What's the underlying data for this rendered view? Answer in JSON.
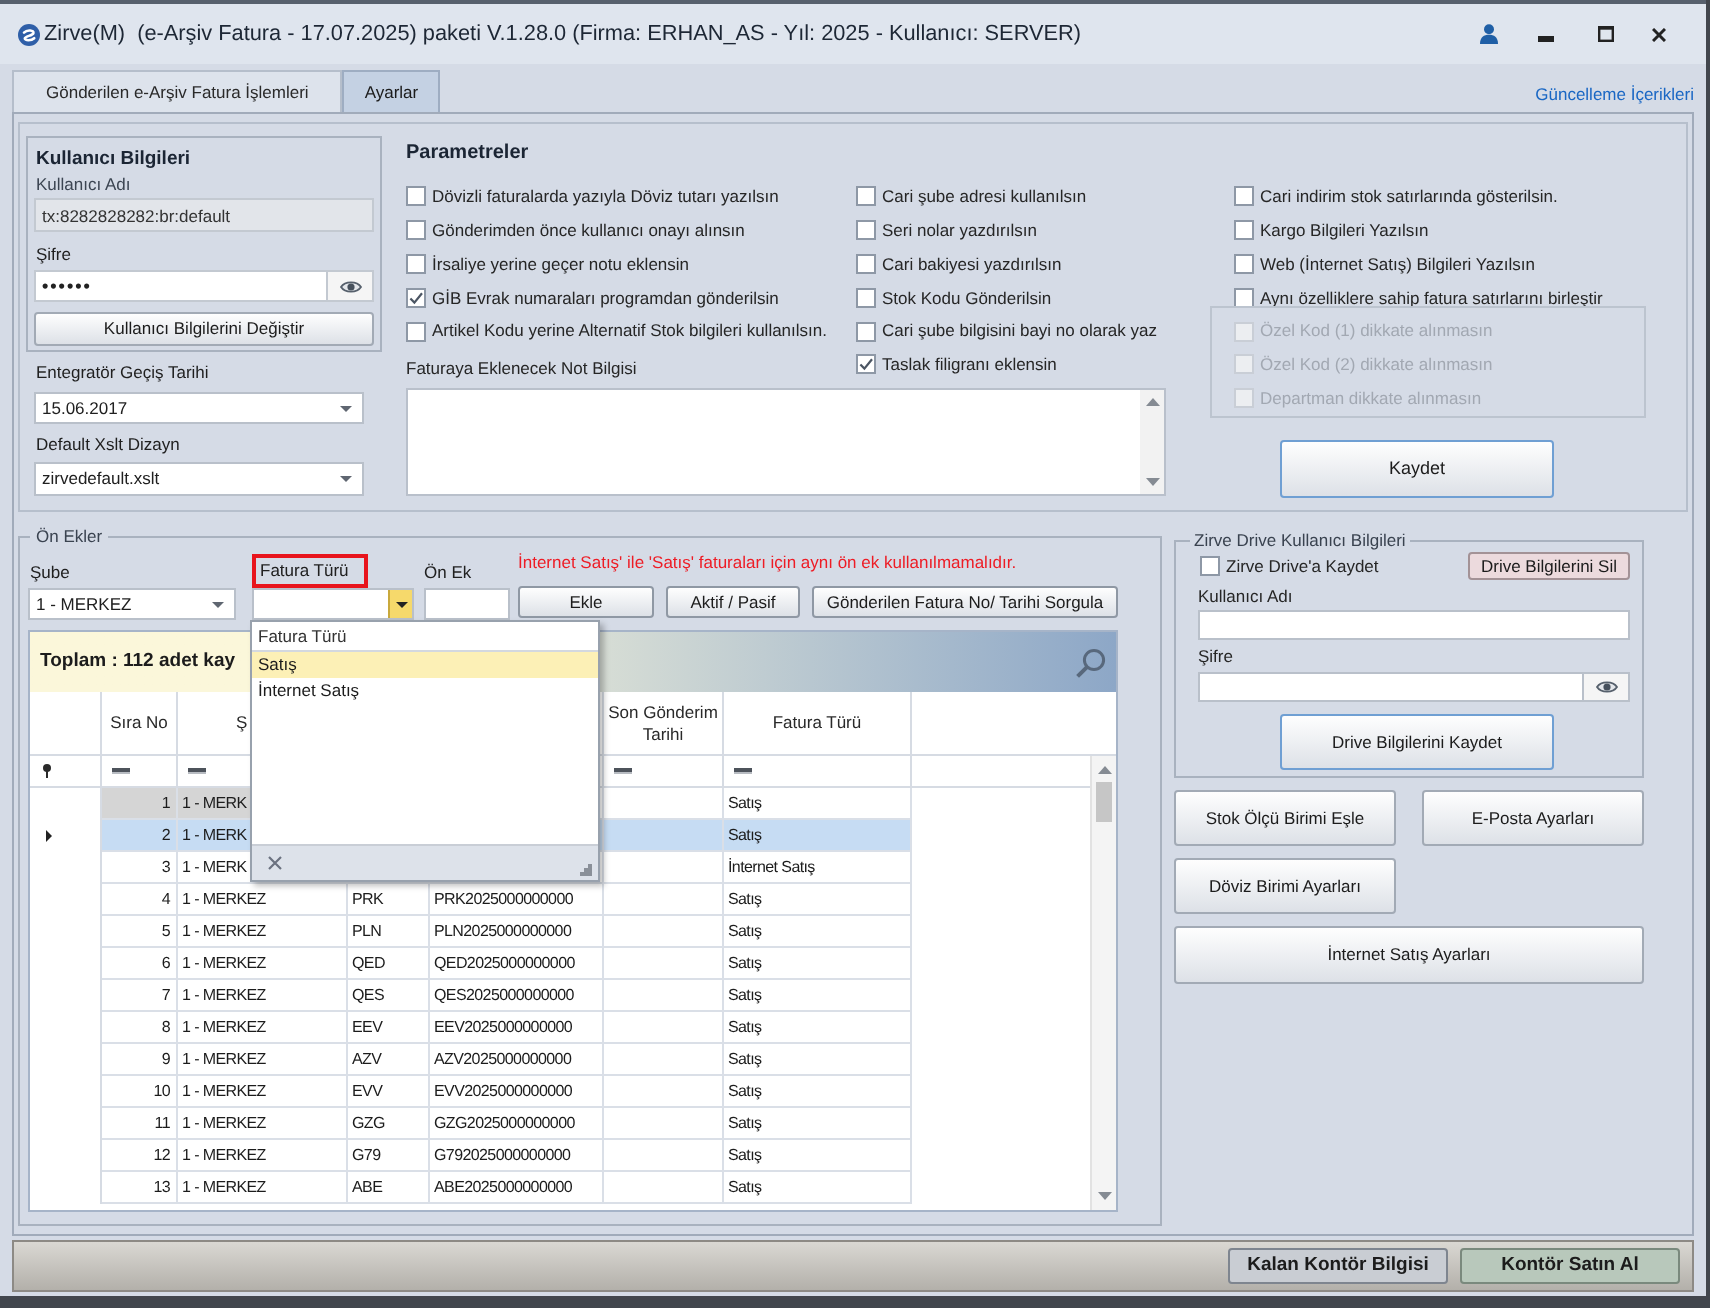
{
  "window": {
    "title": "Zirve(M)  (e-Arşiv Fatura - 17.07.2025) paketi V.1.28.0 (Firma: ERHAN_AS - Yıl: 2025 - Kullanıcı: SERVER)"
  },
  "tabs": [
    {
      "label": "Gönderilen e-Arşiv Fatura İşlemleri",
      "selected": false
    },
    {
      "label": "Ayarlar",
      "selected": true
    }
  ],
  "update_link": "Güncelleme İçerikleri",
  "user_info": {
    "title": "Kullanıcı Bilgileri",
    "username_label": "Kullanıcı Adı",
    "username": "tx:8282828282:br:default",
    "password_label": "Şifre",
    "password": "••••••",
    "change_button": "Kullanıcı Bilgilerini Değiştir"
  },
  "integrator_date": {
    "label": "Entegratör Geçiş Tarihi",
    "value": "15.06.2017"
  },
  "default_xslt": {
    "label": "Default Xslt Dizayn",
    "value": "zirvedefault.xslt"
  },
  "parameters": {
    "title": "Parametreler",
    "columns": [
      [
        {
          "label": "Dövizli faturalarda yazıyla Döviz tutarı yazılsın",
          "checked": false
        },
        {
          "label": "Gönderimden önce kullanıcı onayı alınsın",
          "checked": false
        },
        {
          "label": "İrsaliye yerine geçer notu eklensin",
          "checked": false
        },
        {
          "label": "GİB Evrak numaraları programdan gönderilsin",
          "checked": true
        },
        {
          "label": "Artikel Kodu yerine Alternatif Stok bilgileri kullanılsın.",
          "checked": false
        }
      ],
      [
        {
          "label": "Cari şube adresi kullanılsın",
          "checked": false
        },
        {
          "label": "Seri nolar yazdırılsın",
          "checked": false
        },
        {
          "label": "Cari bakiyesi yazdırılsın",
          "checked": false
        },
        {
          "label": "Stok Kodu Gönderilsin",
          "checked": false
        },
        {
          "label": "Cari şube bilgisini bayi no olarak yaz",
          "checked": false
        },
        {
          "label": "Taslak filigranı eklensin",
          "checked": true
        }
      ],
      [
        {
          "label": "Cari indirim stok satırlarında gösterilsin.",
          "checked": false
        },
        {
          "label": "Kargo Bilgileri Yazılsın",
          "checked": false
        },
        {
          "label": "Web (İnternet Satış) Bilgileri Yazılsın",
          "checked": false
        },
        {
          "label": "Aynı özelliklere sahip fatura satırlarını birleştir",
          "checked": false,
          "children": [
            {
              "label": "Özel Kod (1) dikkate alınmasın",
              "checked": false,
              "disabled": true
            },
            {
              "label": "Özel Kod (2) dikkate alınmasın",
              "checked": false,
              "disabled": true
            },
            {
              "label": "Departman dikkate alınmasın",
              "checked": false,
              "disabled": true
            }
          ]
        }
      ]
    ],
    "note_label": "Faturaya Eklenecek Not Bilgisi",
    "save_button": "Kaydet"
  },
  "prefixes": {
    "title": "Ön Ekler",
    "branch": {
      "label": "Şube",
      "value": "1 - MERKEZ"
    },
    "invoice_type": {
      "label": "Fatura Türü",
      "marked": true,
      "open": true,
      "options_header": "Fatura Türü",
      "options": [
        {
          "label": "Satış",
          "selected": true
        },
        {
          "label": "İnternet Satış",
          "selected": false
        }
      ]
    },
    "prefix": {
      "label": "Ön Ek"
    },
    "warning": "İnternet Satış' ile 'Satış' faturaları için aynı ön ek kullanılmamalıdır.",
    "buttons": [
      "Ekle",
      "Aktif / Pasif",
      "Gönderilen Fatura No/ Tarihi Sorgula"
    ],
    "grid": {
      "summary": "Toplam : 112 adet kay",
      "columns": [
        "Sıra No",
        "Ş",
        null,
        null,
        "Son Gönderim Tarihi",
        "Fatura Türü"
      ],
      "rows": [
        {
          "cells": [
            "1",
            "1 - MERK",
            null,
            null,
            null,
            "Satış"
          ],
          "selected": false,
          "focused": true
        },
        {
          "cells": [
            "2",
            "1 - MERK",
            null,
            null,
            null,
            "Satış"
          ],
          "selected": true,
          "focused": false
        },
        {
          "cells": [
            "3",
            "1 - MERK",
            null,
            null,
            null,
            "İnternet Satış"
          ],
          "selected": false,
          "focused": false
        },
        {
          "cells": [
            "4",
            "1 - MERKEZ",
            "PRK",
            "PRK2025000000000",
            null,
            "Satış"
          ],
          "selected": false,
          "focused": false
        },
        {
          "cells": [
            "5",
            "1 - MERKEZ",
            "PLN",
            "PLN2025000000000",
            null,
            "Satış"
          ],
          "selected": false,
          "focused": false
        },
        {
          "cells": [
            "6",
            "1 - MERKEZ",
            "QED",
            "QED2025000000000",
            null,
            "Satış"
          ],
          "selected": false,
          "focused": false
        },
        {
          "cells": [
            "7",
            "1 - MERKEZ",
            "QES",
            "QES2025000000000",
            null,
            "Satış"
          ],
          "selected": false,
          "focused": false
        },
        {
          "cells": [
            "8",
            "1 - MERKEZ",
            "EEV",
            "EEV2025000000000",
            null,
            "Satış"
          ],
          "selected": false,
          "focused": false
        },
        {
          "cells": [
            "9",
            "1 - MERKEZ",
            "AZV",
            "AZV2025000000000",
            null,
            "Satış"
          ],
          "selected": false,
          "focused": false
        },
        {
          "cells": [
            "10",
            "1 - MERKEZ",
            "EVV",
            "EVV2025000000000",
            null,
            "Satış"
          ],
          "selected": false,
          "focused": false
        },
        {
          "cells": [
            "11",
            "1 - MERKEZ",
            "GZG",
            "GZG2025000000000",
            null,
            "Satış"
          ],
          "selected": false,
          "focused": false
        },
        {
          "cells": [
            "12",
            "1 - MERKEZ",
            "G79",
            "G792025000000000",
            null,
            "Satış"
          ],
          "selected": false,
          "focused": false
        },
        {
          "cells": [
            "13",
            "1 - MERKEZ",
            "ABE",
            "ABE2025000000000",
            null,
            "Satış"
          ],
          "selected": false,
          "focused": false
        }
      ]
    }
  },
  "drive": {
    "title": "Zirve Drive Kullanıcı Bilgileri",
    "save_to_drive": {
      "label": "Zirve Drive'a Kaydet",
      "checked": false
    },
    "delete_button": "Drive Bilgilerini Sil",
    "username_label": "Kullanıcı Adı",
    "password_label": "Şifre",
    "save_button": "Drive Bilgilerini Kaydet"
  },
  "settings_buttons": [
    {
      "label": "Stok Ölçü Birimi Eşle",
      "wide": false
    },
    {
      "label": "E-Posta Ayarları",
      "wide": false
    },
    {
      "label": "Döviz Birimi Ayarları",
      "wide": false
    },
    {
      "label": "İnternet Satış Ayarları",
      "wide": true
    }
  ],
  "footer_buttons": [
    {
      "label": "Kalan Kontör Bilgisi",
      "kind": "info"
    },
    {
      "label": "Kontör Satın Al",
      "kind": "purchase"
    }
  ]
}
